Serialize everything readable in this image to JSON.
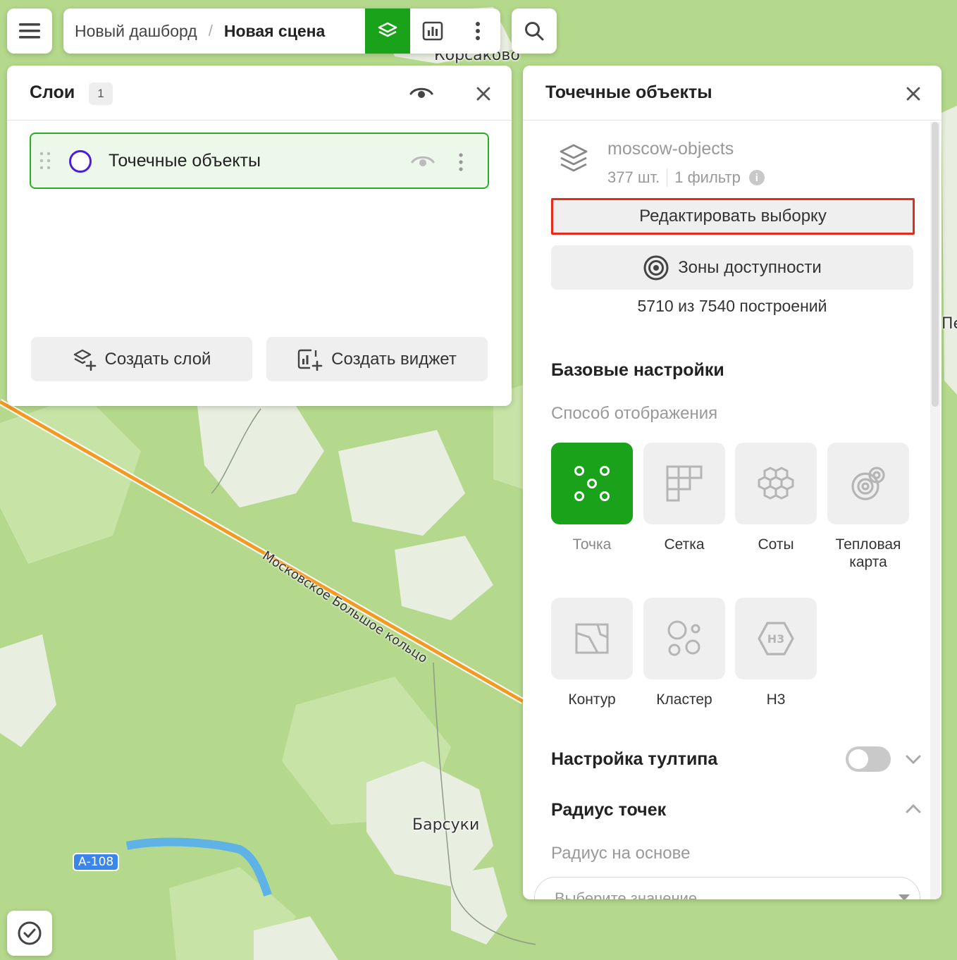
{
  "map": {
    "labels": {
      "korsakovo": "Корсаково",
      "barsuki": "Барсуки",
      "pe": "Пе"
    },
    "road_name": "Московское Большое кольцо",
    "highway_shield": "А-108",
    "colors": {
      "forest": "#b4d98c",
      "clearing": "#e8eee0",
      "road": "#f29a22",
      "water": "#5eb2e6"
    }
  },
  "toolbar": {
    "menu_icon": "hamburger-icon",
    "breadcrumb": {
      "dashboard": "Новый дашборд",
      "separator": "/",
      "scene": "Новая сцена"
    },
    "buttons": [
      "layers-icon",
      "chart-icon",
      "more-vertical-icon"
    ],
    "active_button": "layers-icon",
    "search_icon": "search-icon",
    "accent": "#1ba21b"
  },
  "layers_panel": {
    "title": "Слои",
    "count": "1",
    "layers": [
      {
        "name": "Точечные объекты",
        "color": "#4a1ee0",
        "visible": true,
        "selected": true
      }
    ],
    "create_layer": "Создать слой",
    "create_widget": "Создать виджет"
  },
  "props_panel": {
    "title": "Точечные объекты",
    "dataset": {
      "name": "moscow-objects",
      "count": "377 шт.",
      "filters": "1 фильтр",
      "info_icon": "i"
    },
    "edit_selection": "Редактировать выборку",
    "zones_button": "Зоны доступности",
    "quota": "5710 из 7540 построений",
    "base_settings": "Базовые настройки",
    "display_method": "Способ отображения",
    "modes": [
      {
        "label": "Точка",
        "icon": "points-icon",
        "selected": true
      },
      {
        "label": "Сетка",
        "icon": "grid-icon",
        "selected": false
      },
      {
        "label": "Соты",
        "icon": "hexagons-icon",
        "selected": false
      },
      {
        "label": "Тепловая карта",
        "icon": "heatmap-icon",
        "selected": false
      },
      {
        "label": "Контур",
        "icon": "contour-icon",
        "selected": false
      },
      {
        "label": "Кластер",
        "icon": "cluster-icon",
        "selected": false
      },
      {
        "label": "Н3",
        "icon": "h3-icon",
        "selected": false
      }
    ],
    "h3_badge": "H3",
    "tooltip_settings": "Настройка тултипа",
    "tooltip_enabled": false,
    "point_radius": "Радиус точек",
    "radius_based_on": "Радиус на основе",
    "select_placeholder": "Выберите значение"
  },
  "footer": {
    "clock_icon": "clock-icon"
  }
}
